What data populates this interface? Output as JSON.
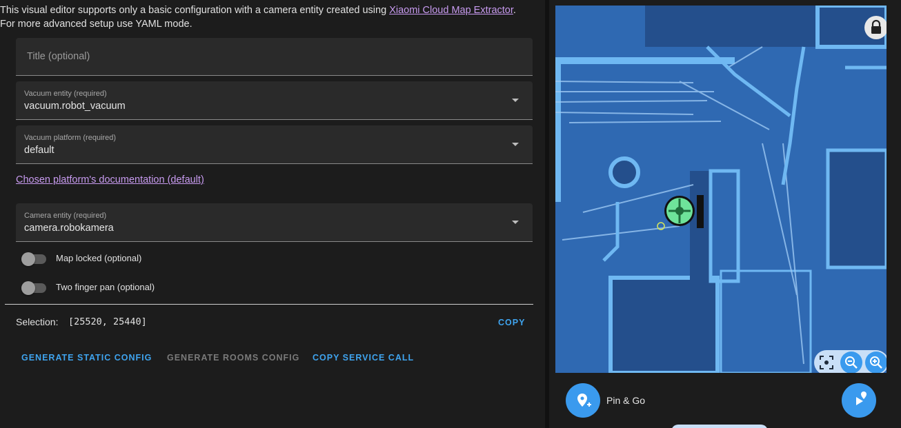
{
  "intro": {
    "text_before": "This visual editor supports only a basic configuration with a camera entity created using ",
    "link": "Xiaomi Cloud Map Extractor",
    "text_after": ".",
    "line2": "For more advanced setup use YAML mode."
  },
  "fields": {
    "title": {
      "placeholder": "Title (optional)"
    },
    "vacuum_entity": {
      "label": "Vacuum entity (required)",
      "value": "vacuum.robot_vacuum"
    },
    "vacuum_platform": {
      "label": "Vacuum platform (required)",
      "value": "default"
    },
    "camera_entity": {
      "label": "Camera entity (required)",
      "value": "camera.robokamera"
    }
  },
  "doc_link": "Chosen platform's documentation (default)",
  "toggles": {
    "map_locked": {
      "label": "Map locked (optional)",
      "checked": false
    },
    "two_finger_pan": {
      "label": "Two finger pan (optional)",
      "checked": false
    }
  },
  "selection": {
    "label": "Selection:",
    "value": "[25520, 25440]",
    "copy": "COPY"
  },
  "actions": {
    "generate_static": "GENERATE STATIC CONFIG",
    "generate_rooms": "GENERATE ROOMS CONFIG",
    "copy_service": "COPY SERVICE CALL"
  },
  "map_panel": {
    "mode_label": "Pin & Go",
    "icons": {
      "lock": "lock-icon",
      "recenter": "focus-icon",
      "zoom_out": "zoom-out-icon",
      "zoom_in": "zoom-in-icon",
      "pin": "map-marker-plus-icon",
      "run": "play-marker-icon"
    }
  },
  "colors": {
    "accent": "#3fa4ef",
    "link": "#c89bf0",
    "map_floor": "#2f69b2",
    "map_walls": "#6fb8f2",
    "robot": "#6ee39a"
  }
}
